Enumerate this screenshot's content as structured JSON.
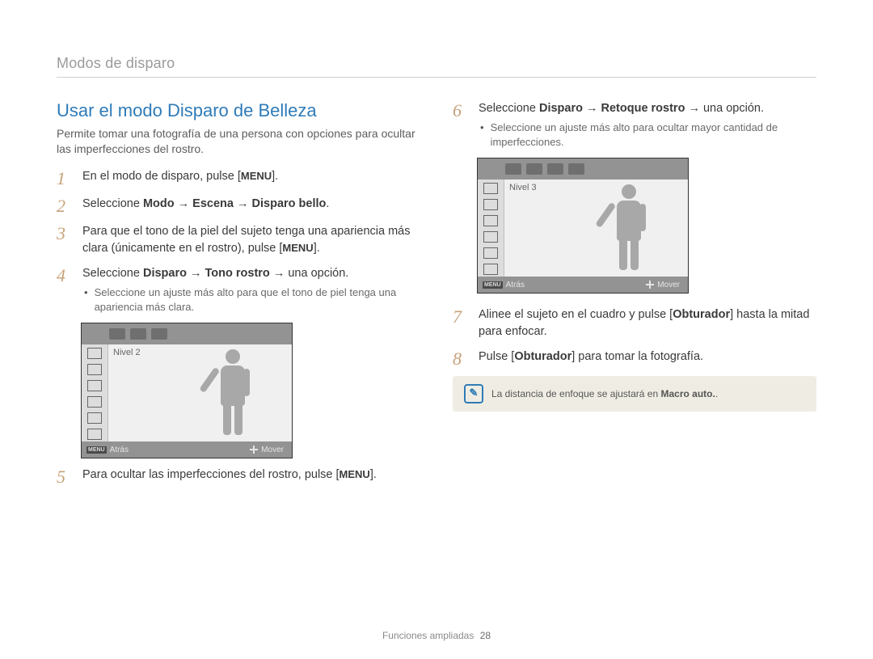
{
  "breadcrumb": "Modos de disparo",
  "heading": "Usar el modo Disparo de Belleza",
  "intro": "Permite tomar una fotografía de una persona con opciones para ocultar las imperfecciones del rostro.",
  "steps": {
    "s1": {
      "num": "1",
      "a": "En el modo de disparo, pulse [",
      "menu": "MENU",
      "b": "]."
    },
    "s2": {
      "num": "2",
      "a": "Seleccione ",
      "bold": "Modo → Escena → Disparo bello",
      "b": "."
    },
    "s3": {
      "num": "3",
      "a": "Para que el tono de la piel del sujeto tenga una apariencia más clara (únicamente en el rostro), pulse [",
      "menu": "MENU",
      "b": "]."
    },
    "s4": {
      "num": "4",
      "a": "Seleccione ",
      "bold": "Disparo → Tono rostro",
      "b": " → una opción.",
      "bullet": "Seleccione un ajuste más alto para que el tono de piel tenga una apariencia más clara."
    },
    "s5": {
      "num": "5",
      "a": "Para ocultar las imperfecciones del rostro, pulse [",
      "menu": "MENU",
      "b": "]."
    },
    "s6": {
      "num": "6",
      "a": "Seleccione ",
      "bold": "Disparo → Retoque rostro",
      "b": " → una opción.",
      "bullet": "Seleccione un ajuste más alto para ocultar mayor cantidad de imperfecciones."
    },
    "s7": {
      "num": "7",
      "a": "Alinee el sujeto en el cuadro y pulse [",
      "bold": "Obturador",
      "b": "] hasta la mitad para enfocar."
    },
    "s8": {
      "num": "8",
      "a": "Pulse [",
      "bold": "Obturador",
      "b": "] para tomar la fotografía."
    }
  },
  "lcd": {
    "level2": "Nivel 2",
    "level3": "Nivel 3",
    "menu_tag": "MENU",
    "back": "Atrás",
    "move": "Mover"
  },
  "note": {
    "a": "La distancia de enfoque se ajustará en ",
    "bold": "Macro auto.",
    "b": "."
  },
  "footer": {
    "section": "Funciones ampliadas",
    "page": "28"
  }
}
